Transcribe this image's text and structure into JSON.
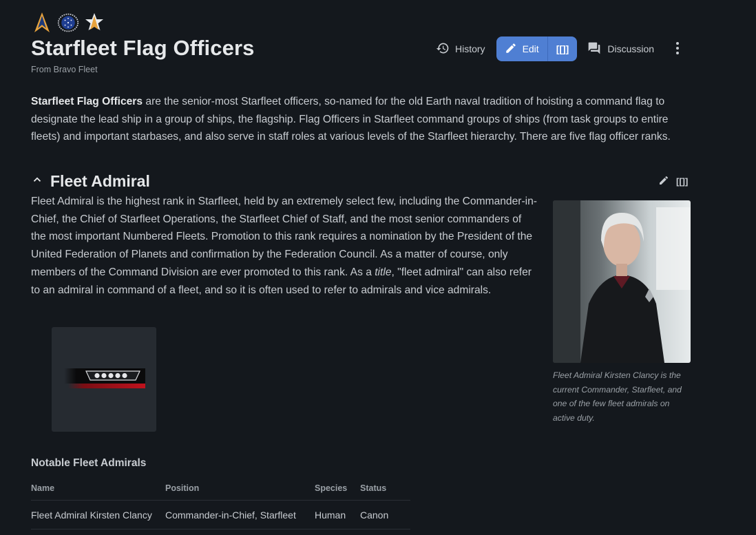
{
  "icons": [
    "starfleet-delta-icon",
    "ufp-seal-icon",
    "star-delta-icon",
    "history-icon",
    "pencil-icon",
    "discussion-icon",
    "more-vertical-icon",
    "chevron-up-icon"
  ],
  "page": {
    "title": "Starfleet Flag Officers",
    "subtitle": "From Bravo Fleet"
  },
  "actions": {
    "history": "History",
    "edit": "Edit",
    "edit_source": "[[]]",
    "discussion": "Discussion"
  },
  "intro": {
    "bold": "Starfleet Flag Officers",
    "text": " are the senior-most Starfleet officers, so-named for the old Earth naval tradition of hoisting a command flag to designate the lead ship in a group of ships, the flagship. Flag Officers in Starfleet command groups of ships (from task groups to entire fleets) and important starbases, and also serve in staff roles at various levels of the Starfleet hierarchy. There are five flag officer ranks."
  },
  "section": {
    "heading": "Fleet Admiral",
    "edit_source": "[[]]",
    "body_a": "Fleet Admiral is the highest rank in Starfleet, held by an extremely select few, including the Commander-in-Chief, the Chief of Starfleet Operations, the Starfleet Chief of Staff, and the most senior commanders of the most important Numbered Fleets. Promotion to this rank requires a nomination by the President of the United Federation of Planets and confirmation by the Federation Council. As a matter of course, only members of the Command Division are ever promoted to this rank. As a ",
    "body_em": "title",
    "body_b": ", \"fleet admiral\" can also refer to an admiral in command of a fleet, and so it is often used to refer to admirals and vice admirals.",
    "caption": "Fleet Admiral Kirsten Clancy is the current Commander, Starfleet, and one of the few fleet admirals on active duty."
  },
  "table": {
    "title": "Notable Fleet Admirals",
    "columns": [
      "Name",
      "Position",
      "Species",
      "Status"
    ],
    "rows": [
      [
        "Fleet Admiral Kirsten Clancy",
        "Commander-in-Chief, Starfleet",
        "Human",
        "Canon"
      ]
    ]
  },
  "colors": {
    "background": "#14181d",
    "accent": "#4f7fd3",
    "link": "#6b95e0",
    "species": "#e0575f"
  }
}
